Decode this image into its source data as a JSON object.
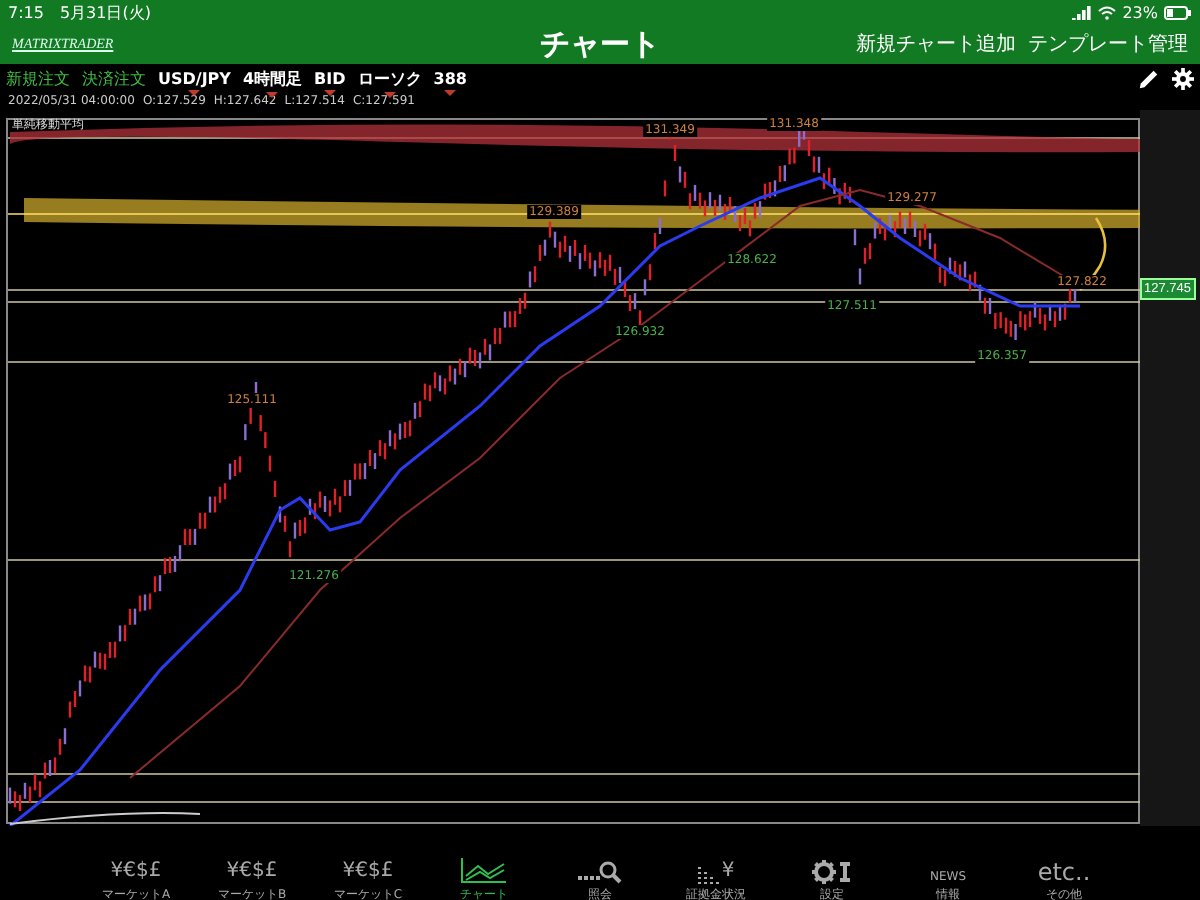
{
  "status_bar": {
    "time": "7:15",
    "date": "5月31日(火)",
    "battery": "23%"
  },
  "header": {
    "logo": "MATRIXTRADER",
    "title": "チャート",
    "actions": [
      "新規チャート追加",
      "テンプレート管理"
    ]
  },
  "toolbar": {
    "orders": [
      "新規注文",
      "決済注文"
    ],
    "dropdowns": [
      "USD/JPY",
      "4時間足",
      "BID",
      "ローソク",
      "388"
    ]
  },
  "ohlc": {
    "time": "2022/05/31 04:00:00",
    "values": [
      "O:127.529",
      "H:127.642",
      "L:127.514",
      "C:127.591"
    ]
  },
  "chart": {
    "legend": "単純移動平均",
    "current_price": "127.745",
    "price_labels": [
      {
        "text": "131.349",
        "kind": "high"
      },
      {
        "text": "131.348",
        "kind": "high"
      },
      {
        "text": "129.277",
        "kind": "high"
      },
      {
        "text": "129.389",
        "kind": "high"
      },
      {
        "text": "128.622",
        "kind": "low"
      },
      {
        "text": "126.932",
        "kind": "low"
      },
      {
        "text": "127.511",
        "kind": "low"
      },
      {
        "text": "126.357",
        "kind": "low"
      },
      {
        "text": "127.822",
        "kind": "high"
      },
      {
        "text": "125.111",
        "kind": "high"
      },
      {
        "text": "121.276",
        "kind": "low"
      }
    ]
  },
  "tab_bar": [
    {
      "kind": "currency",
      "glyph": "¥€$£",
      "label": "マーケットA",
      "selected": false
    },
    {
      "kind": "currency",
      "glyph": "¥€$£",
      "label": "マーケットB",
      "selected": false
    },
    {
      "kind": "currency",
      "glyph": "¥€$£",
      "label": "マーケットC",
      "selected": false
    },
    {
      "kind": "chart",
      "label": "チャート",
      "selected": true
    },
    {
      "kind": "search",
      "label": "照会",
      "selected": false
    },
    {
      "kind": "margin",
      "glyph": "¥",
      "label": "証拠金状況",
      "selected": false
    },
    {
      "kind": "settings",
      "label": "設定",
      "selected": false
    },
    {
      "kind": "news",
      "glyph": "NEWS",
      "label": "情報",
      "selected": false
    },
    {
      "kind": "etc",
      "glyph": "etc..",
      "label": "その他",
      "selected": false
    }
  ]
}
